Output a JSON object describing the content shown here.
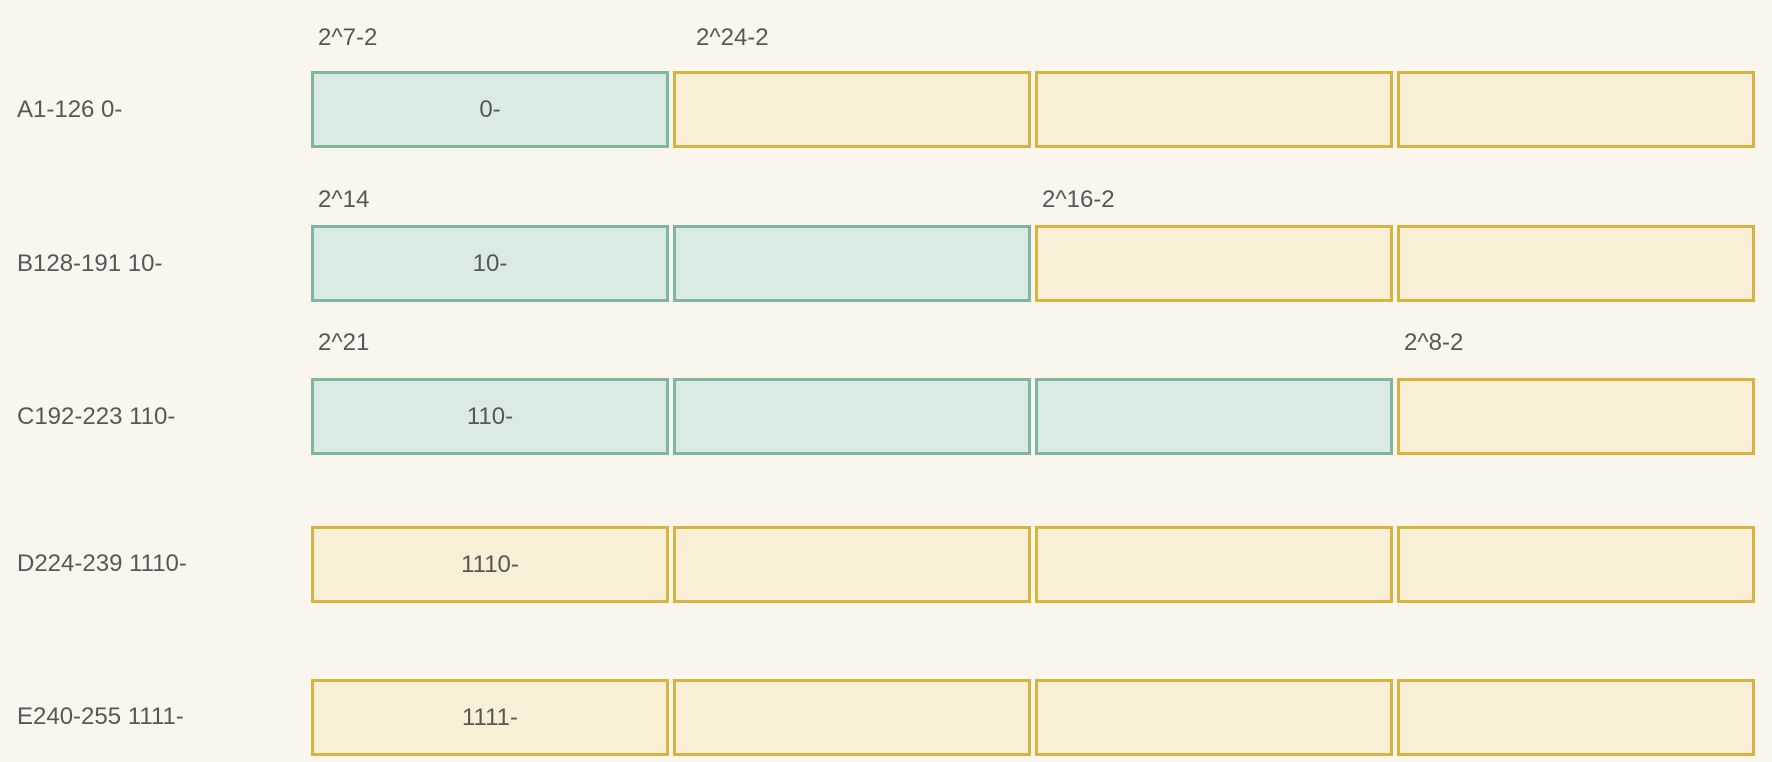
{
  "colors": {
    "background": "#faf6ee",
    "network_fill": "#d9ebe3",
    "network_border": "#7fb6a2",
    "host_fill": "#f8efd6",
    "host_border": "#d6b43f",
    "text": "#575757"
  },
  "rows": [
    {
      "label": "A1-126 0-",
      "prefix": "0-",
      "net_label": "2^7-2",
      "host_label": "2^24-2"
    },
    {
      "label": "B128-191 10-",
      "prefix": "10-",
      "net_label": "2^14",
      "host_label": "2^16-2"
    },
    {
      "label": "C192-223 110-",
      "prefix": "110-",
      "net_label": "2^21",
      "host_label": "2^8-2"
    },
    {
      "label": "D224-239 1110-",
      "prefix": "1110-"
    },
    {
      "label": "E240-255 1111-",
      "prefix": "1111-"
    }
  ]
}
